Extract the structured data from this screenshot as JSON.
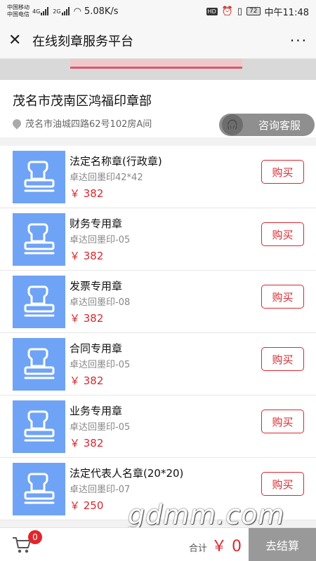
{
  "status": {
    "carrier1": "中国移动",
    "carrier2": "中国电信",
    "net1": "4G",
    "net2": "2G",
    "speed": "5.08K/s",
    "hd": "HD",
    "battery": "72",
    "time": "中午11:48"
  },
  "titlebar": {
    "title": "在线刻章服务平台",
    "close": "✕",
    "more": "···"
  },
  "shop": {
    "name": "茂名市茂南区鸿福印章部",
    "address": "茂名市油城四路62号102房A间",
    "consult_label": "咨询客服"
  },
  "products": [
    {
      "name": "法定名称章(行政章)",
      "desc": "卓达回墨印42*42",
      "price": "￥ 382",
      "buy": "购买"
    },
    {
      "name": "财务专用章",
      "desc": "卓达回墨印-05",
      "price": "￥ 382",
      "buy": "购买"
    },
    {
      "name": "发票专用章",
      "desc": "卓达回墨印-08",
      "price": "￥ 382",
      "buy": "购买"
    },
    {
      "name": "合同专用章",
      "desc": "卓达回墨印-05",
      "price": "￥ 382",
      "buy": "购买"
    },
    {
      "name": "业务专用章",
      "desc": "卓达回墨印-05",
      "price": "￥ 382",
      "buy": "购买"
    },
    {
      "name": "法定代表人名章(20*20)",
      "desc": "卓达回墨印-07",
      "price": "￥ 250",
      "buy": "购买"
    }
  ],
  "footer": {
    "cart_count": "0",
    "total_label": "合计",
    "total_value": "￥ 0",
    "checkout": "去结算"
  },
  "watermark": "gdmm.com",
  "colors": {
    "accent": "#d9282f",
    "thumb": "#6fa3f5"
  }
}
